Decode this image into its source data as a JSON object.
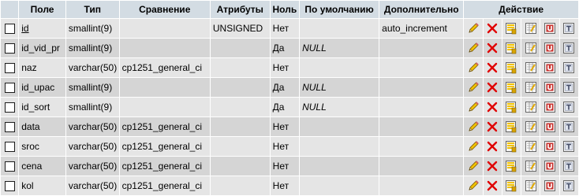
{
  "columns": {
    "field": "Поле",
    "type": "Тип",
    "collation": "Сравнение",
    "attributes": "Атрибуты",
    "null": "Ноль",
    "default": "По умолчанию",
    "extra": "Дополнительно",
    "action": "Действие"
  },
  "rows": [
    {
      "field": "id",
      "type": "smallint(9)",
      "collation": "",
      "attributes": "UNSIGNED",
      "null": "Нет",
      "default": "",
      "extra": "auto_increment"
    },
    {
      "field": "id_vid_pr",
      "type": "smallint(9)",
      "collation": "",
      "attributes": "",
      "null": "Да",
      "default": "NULL",
      "extra": ""
    },
    {
      "field": "naz",
      "type": "varchar(50)",
      "collation": "cp1251_general_ci",
      "attributes": "",
      "null": "Нет",
      "default": "",
      "extra": ""
    },
    {
      "field": "id_upac",
      "type": "smallint(9)",
      "collation": "",
      "attributes": "",
      "null": "Да",
      "default": "NULL",
      "extra": ""
    },
    {
      "field": "id_sort",
      "type": "smallint(9)",
      "collation": "",
      "attributes": "",
      "null": "Да",
      "default": "NULL",
      "extra": ""
    },
    {
      "field": "data",
      "type": "varchar(50)",
      "collation": "cp1251_general_ci",
      "attributes": "",
      "null": "Нет",
      "default": "",
      "extra": ""
    },
    {
      "field": "sroc",
      "type": "varchar(50)",
      "collation": "cp1251_general_ci",
      "attributes": "",
      "null": "Нет",
      "default": "",
      "extra": ""
    },
    {
      "field": "cena",
      "type": "varchar(50)",
      "collation": "cp1251_general_ci",
      "attributes": "",
      "null": "Нет",
      "default": "",
      "extra": ""
    },
    {
      "field": "kol",
      "type": "varchar(50)",
      "collation": "cp1251_general_ci",
      "attributes": "",
      "null": "Нет",
      "default": "",
      "extra": ""
    }
  ],
  "row_actions": [
    "pencil-edit-icon",
    "delete-x-icon",
    "primary-key-icon",
    "index-icon",
    "unique-icon",
    "fulltext-icon"
  ],
  "colors": {
    "header_bg": "#d3dce3",
    "row_odd": "#e5e5e5",
    "row_even": "#d5d5d5",
    "delete_red": "#e00000",
    "pencil_yellow": "#f2c200"
  }
}
